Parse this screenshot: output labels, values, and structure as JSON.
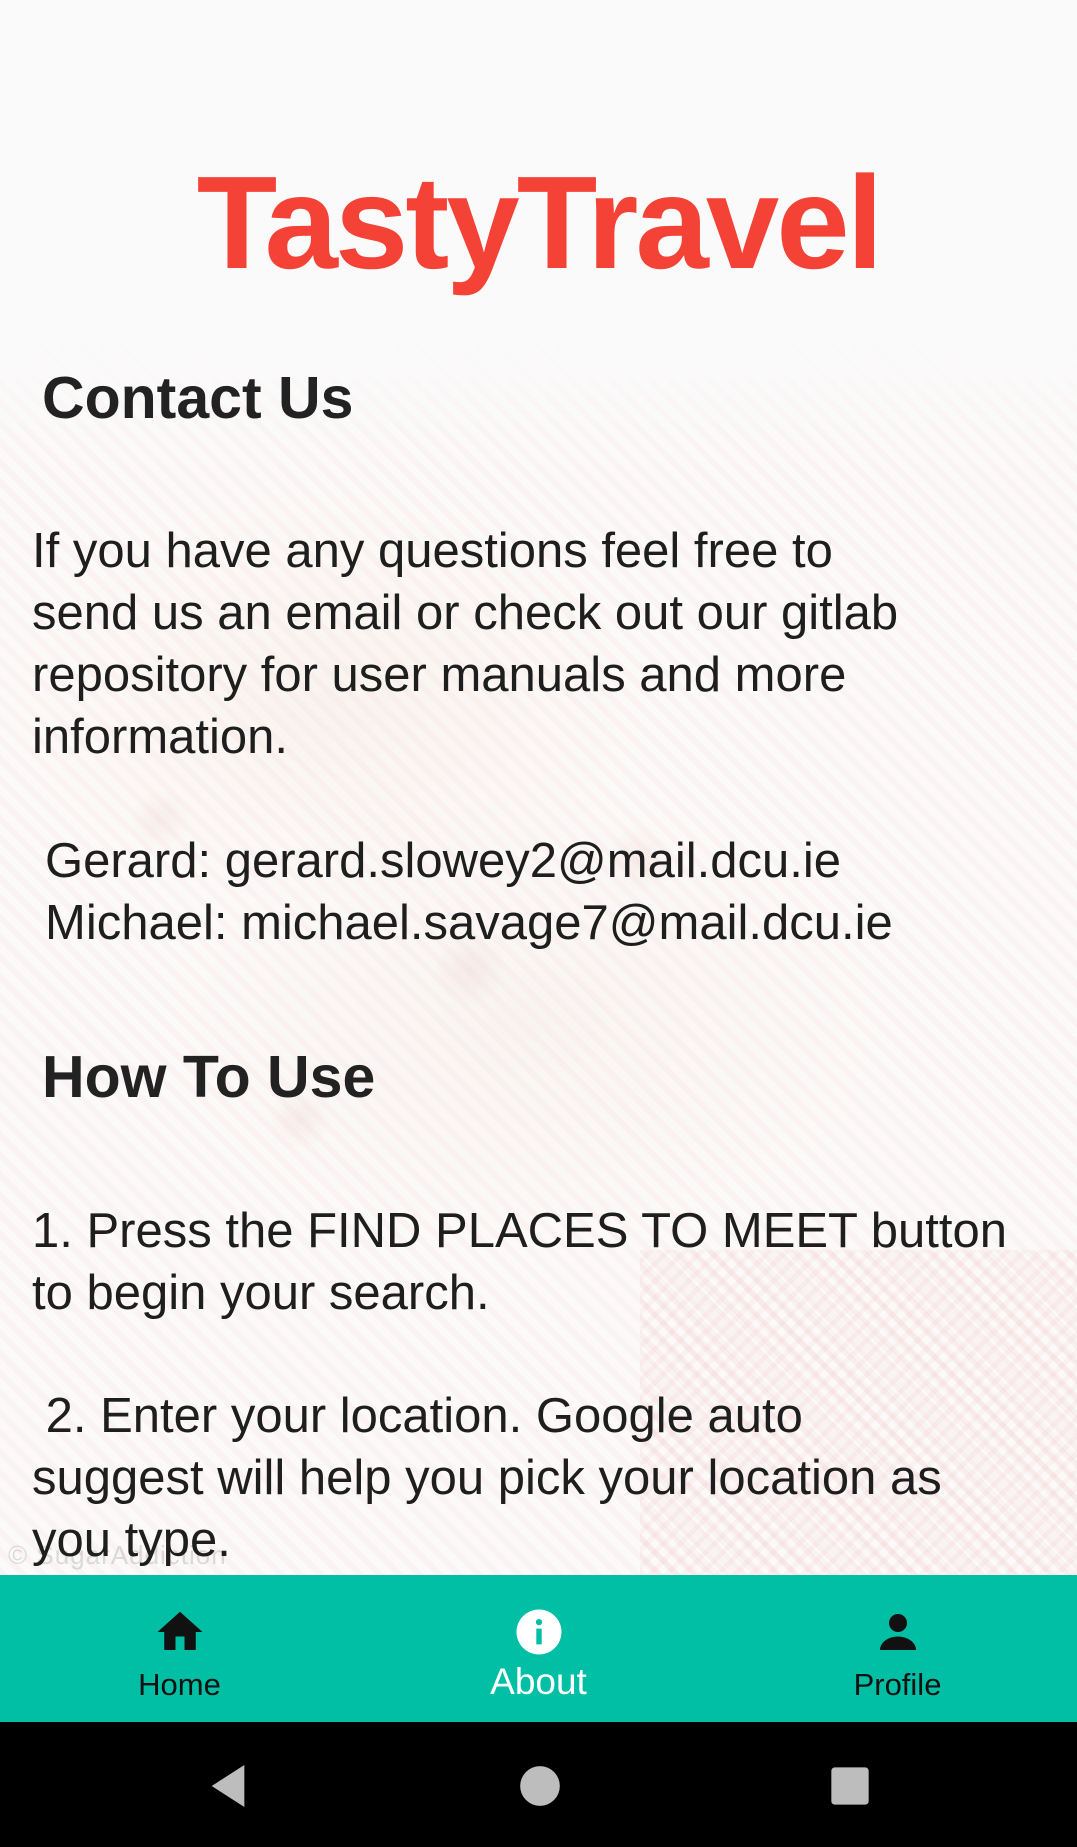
{
  "app": {
    "title": "TastyTravel",
    "title_color": "#f44336"
  },
  "contact": {
    "heading": "Contact Us",
    "paragraph_lines": [
      "If you have any questions feel free to",
      "send us an email or check out our gitlab",
      "repository for user manuals and more",
      "information."
    ],
    "emails": [
      "Gerard: gerard.slowey2@mail.dcu.ie",
      "Michael: michael.savage7@mail.dcu.ie"
    ]
  },
  "how_to_use": {
    "heading": "How To Use",
    "step1_lines": [
      "1. Press the FIND PLACES TO MEET button",
      "to begin your search."
    ],
    "step2_lines": [
      " 2. Enter your location. Google auto",
      "suggest will help you pick your location as",
      "you type."
    ]
  },
  "background": {
    "watermark": "© SugarAddiction"
  },
  "bottom_nav": {
    "background_color": "#00bfa5",
    "items": [
      {
        "label": "Home",
        "icon": "home-icon",
        "active": false
      },
      {
        "label": "About",
        "icon": "info-icon",
        "active": true
      },
      {
        "label": "Profile",
        "icon": "person-icon",
        "active": false
      }
    ]
  },
  "system_nav": {
    "buttons": [
      "back-icon",
      "home-circle-icon",
      "recents-icon"
    ]
  }
}
